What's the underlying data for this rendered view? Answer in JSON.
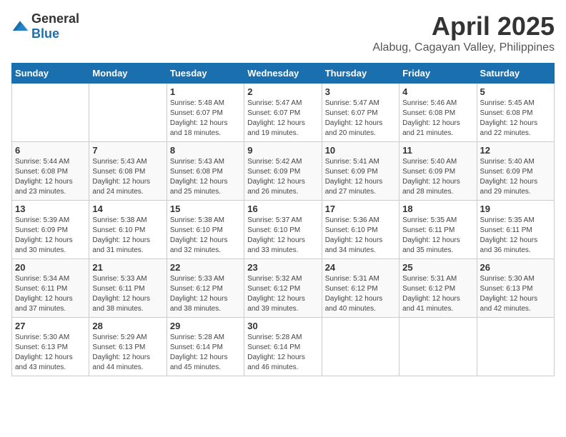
{
  "header": {
    "logo_general": "General",
    "logo_blue": "Blue",
    "title": "April 2025",
    "subtitle": "Alabug, Cagayan Valley, Philippines"
  },
  "calendar": {
    "days_of_week": [
      "Sunday",
      "Monday",
      "Tuesday",
      "Wednesday",
      "Thursday",
      "Friday",
      "Saturday"
    ],
    "weeks": [
      [
        {
          "day": "",
          "sunrise": "",
          "sunset": "",
          "daylight": ""
        },
        {
          "day": "",
          "sunrise": "",
          "sunset": "",
          "daylight": ""
        },
        {
          "day": "1",
          "sunrise": "Sunrise: 5:48 AM",
          "sunset": "Sunset: 6:07 PM",
          "daylight": "Daylight: 12 hours and 18 minutes."
        },
        {
          "day": "2",
          "sunrise": "Sunrise: 5:47 AM",
          "sunset": "Sunset: 6:07 PM",
          "daylight": "Daylight: 12 hours and 19 minutes."
        },
        {
          "day": "3",
          "sunrise": "Sunrise: 5:47 AM",
          "sunset": "Sunset: 6:07 PM",
          "daylight": "Daylight: 12 hours and 20 minutes."
        },
        {
          "day": "4",
          "sunrise": "Sunrise: 5:46 AM",
          "sunset": "Sunset: 6:08 PM",
          "daylight": "Daylight: 12 hours and 21 minutes."
        },
        {
          "day": "5",
          "sunrise": "Sunrise: 5:45 AM",
          "sunset": "Sunset: 6:08 PM",
          "daylight": "Daylight: 12 hours and 22 minutes."
        }
      ],
      [
        {
          "day": "6",
          "sunrise": "Sunrise: 5:44 AM",
          "sunset": "Sunset: 6:08 PM",
          "daylight": "Daylight: 12 hours and 23 minutes."
        },
        {
          "day": "7",
          "sunrise": "Sunrise: 5:43 AM",
          "sunset": "Sunset: 6:08 PM",
          "daylight": "Daylight: 12 hours and 24 minutes."
        },
        {
          "day": "8",
          "sunrise": "Sunrise: 5:43 AM",
          "sunset": "Sunset: 6:08 PM",
          "daylight": "Daylight: 12 hours and 25 minutes."
        },
        {
          "day": "9",
          "sunrise": "Sunrise: 5:42 AM",
          "sunset": "Sunset: 6:09 PM",
          "daylight": "Daylight: 12 hours and 26 minutes."
        },
        {
          "day": "10",
          "sunrise": "Sunrise: 5:41 AM",
          "sunset": "Sunset: 6:09 PM",
          "daylight": "Daylight: 12 hours and 27 minutes."
        },
        {
          "day": "11",
          "sunrise": "Sunrise: 5:40 AM",
          "sunset": "Sunset: 6:09 PM",
          "daylight": "Daylight: 12 hours and 28 minutes."
        },
        {
          "day": "12",
          "sunrise": "Sunrise: 5:40 AM",
          "sunset": "Sunset: 6:09 PM",
          "daylight": "Daylight: 12 hours and 29 minutes."
        }
      ],
      [
        {
          "day": "13",
          "sunrise": "Sunrise: 5:39 AM",
          "sunset": "Sunset: 6:09 PM",
          "daylight": "Daylight: 12 hours and 30 minutes."
        },
        {
          "day": "14",
          "sunrise": "Sunrise: 5:38 AM",
          "sunset": "Sunset: 6:10 PM",
          "daylight": "Daylight: 12 hours and 31 minutes."
        },
        {
          "day": "15",
          "sunrise": "Sunrise: 5:38 AM",
          "sunset": "Sunset: 6:10 PM",
          "daylight": "Daylight: 12 hours and 32 minutes."
        },
        {
          "day": "16",
          "sunrise": "Sunrise: 5:37 AM",
          "sunset": "Sunset: 6:10 PM",
          "daylight": "Daylight: 12 hours and 33 minutes."
        },
        {
          "day": "17",
          "sunrise": "Sunrise: 5:36 AM",
          "sunset": "Sunset: 6:10 PM",
          "daylight": "Daylight: 12 hours and 34 minutes."
        },
        {
          "day": "18",
          "sunrise": "Sunrise: 5:35 AM",
          "sunset": "Sunset: 6:11 PM",
          "daylight": "Daylight: 12 hours and 35 minutes."
        },
        {
          "day": "19",
          "sunrise": "Sunrise: 5:35 AM",
          "sunset": "Sunset: 6:11 PM",
          "daylight": "Daylight: 12 hours and 36 minutes."
        }
      ],
      [
        {
          "day": "20",
          "sunrise": "Sunrise: 5:34 AM",
          "sunset": "Sunset: 6:11 PM",
          "daylight": "Daylight: 12 hours and 37 minutes."
        },
        {
          "day": "21",
          "sunrise": "Sunrise: 5:33 AM",
          "sunset": "Sunset: 6:11 PM",
          "daylight": "Daylight: 12 hours and 38 minutes."
        },
        {
          "day": "22",
          "sunrise": "Sunrise: 5:33 AM",
          "sunset": "Sunset: 6:12 PM",
          "daylight": "Daylight: 12 hours and 38 minutes."
        },
        {
          "day": "23",
          "sunrise": "Sunrise: 5:32 AM",
          "sunset": "Sunset: 6:12 PM",
          "daylight": "Daylight: 12 hours and 39 minutes."
        },
        {
          "day": "24",
          "sunrise": "Sunrise: 5:31 AM",
          "sunset": "Sunset: 6:12 PM",
          "daylight": "Daylight: 12 hours and 40 minutes."
        },
        {
          "day": "25",
          "sunrise": "Sunrise: 5:31 AM",
          "sunset": "Sunset: 6:12 PM",
          "daylight": "Daylight: 12 hours and 41 minutes."
        },
        {
          "day": "26",
          "sunrise": "Sunrise: 5:30 AM",
          "sunset": "Sunset: 6:13 PM",
          "daylight": "Daylight: 12 hours and 42 minutes."
        }
      ],
      [
        {
          "day": "27",
          "sunrise": "Sunrise: 5:30 AM",
          "sunset": "Sunset: 6:13 PM",
          "daylight": "Daylight: 12 hours and 43 minutes."
        },
        {
          "day": "28",
          "sunrise": "Sunrise: 5:29 AM",
          "sunset": "Sunset: 6:13 PM",
          "daylight": "Daylight: 12 hours and 44 minutes."
        },
        {
          "day": "29",
          "sunrise": "Sunrise: 5:28 AM",
          "sunset": "Sunset: 6:14 PM",
          "daylight": "Daylight: 12 hours and 45 minutes."
        },
        {
          "day": "30",
          "sunrise": "Sunrise: 5:28 AM",
          "sunset": "Sunset: 6:14 PM",
          "daylight": "Daylight: 12 hours and 46 minutes."
        },
        {
          "day": "",
          "sunrise": "",
          "sunset": "",
          "daylight": ""
        },
        {
          "day": "",
          "sunrise": "",
          "sunset": "",
          "daylight": ""
        },
        {
          "day": "",
          "sunrise": "",
          "sunset": "",
          "daylight": ""
        }
      ]
    ]
  }
}
